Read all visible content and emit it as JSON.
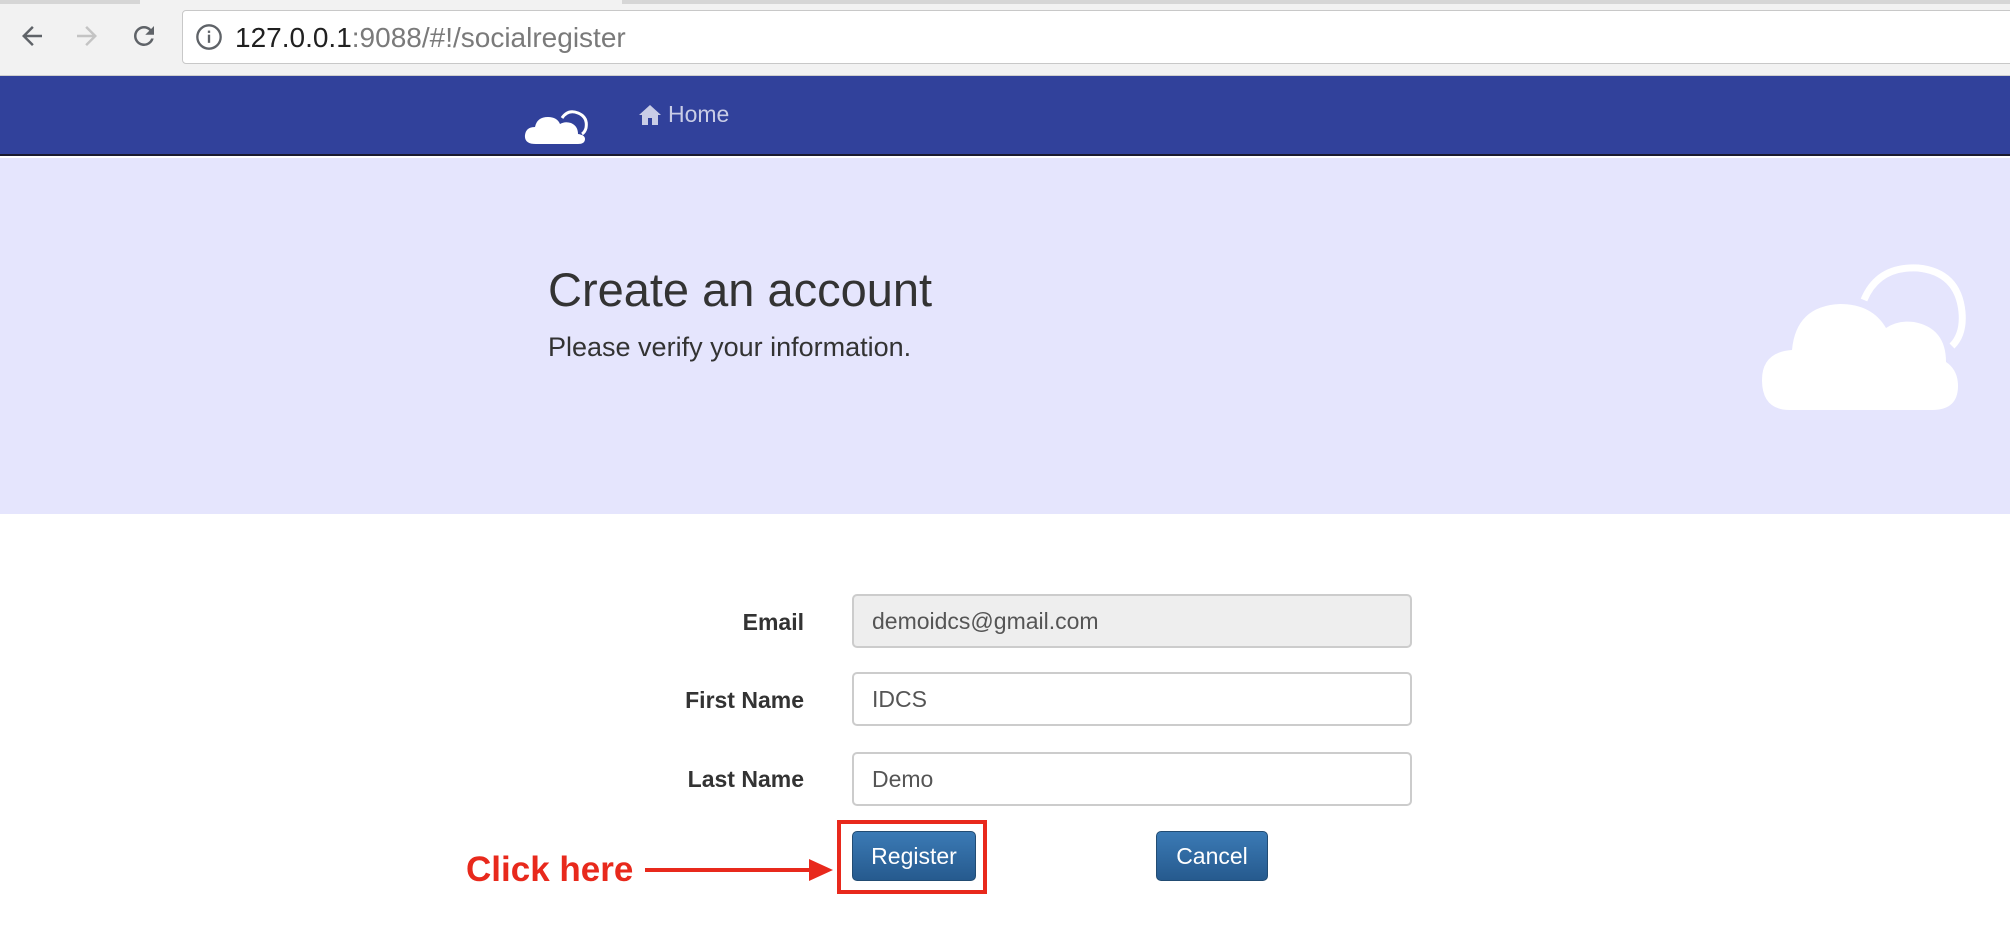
{
  "browser": {
    "url_host": "127.0.0.1",
    "url_rest": ":9088/#!/socialregister",
    "back_icon": "arrow-left-icon",
    "forward_icon": "arrow-right-icon",
    "reload_icon": "reload-icon",
    "info_icon": "info-icon"
  },
  "navbar": {
    "logo_icon": "cloud-icon",
    "home_label": "Home",
    "home_icon": "home-icon",
    "background": "#31419b"
  },
  "hero": {
    "title": "Create an account",
    "subtitle": "Please verify your information.",
    "background": "#e5e5fd",
    "decoration_icon": "cloud-icon"
  },
  "form": {
    "email_label": "Email",
    "email_value": "demoidcs@gmail.com",
    "first_name_label": "First Name",
    "first_name_value": "IDCS",
    "last_name_label": "Last Name",
    "last_name_value": "Demo",
    "register_label": "Register",
    "cancel_label": "Cancel"
  },
  "annotation": {
    "callout_text": "Click here",
    "color": "#e8291c"
  }
}
